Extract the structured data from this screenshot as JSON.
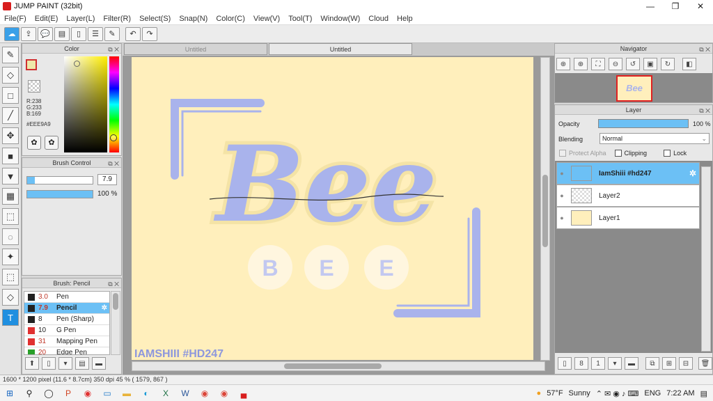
{
  "window": {
    "title": "JUMP PAINT (32bit)",
    "minimize": "—",
    "maximize": "❐",
    "close": "✕"
  },
  "menu": [
    "File(F)",
    "Edit(E)",
    "Layer(L)",
    "Filter(R)",
    "Select(S)",
    "Snap(N)",
    "Color(C)",
    "View(V)",
    "Tool(T)",
    "Window(W)",
    "Cloud",
    "Help"
  ],
  "doc_tabs": [
    "Untitled",
    "Untitled"
  ],
  "color_panel": {
    "title": "Color",
    "r": "R:238",
    "g": "G:233",
    "b": "B:169",
    "hex": "#EEE9A9",
    "fg_color": "#eee9a9"
  },
  "brush_control": {
    "title": "Brush Control",
    "size": "7.9",
    "opacity": "100 %"
  },
  "brush_list": {
    "title": "Brush: Pencil",
    "items": [
      {
        "size": "3.0",
        "name": "Pen",
        "color": "#222222"
      },
      {
        "size": "7.9",
        "name": "Pencil",
        "color": "#222222"
      },
      {
        "size": "8",
        "name": "Pen (Sharp)",
        "color": "#222222"
      },
      {
        "size": "10",
        "name": "G Pen",
        "color": "#e03030"
      },
      {
        "size": "31",
        "name": "Mapping Pen",
        "color": "#e03030"
      },
      {
        "size": "20",
        "name": "Edge Pen",
        "color": "#2aa02a"
      }
    ]
  },
  "artwork": {
    "title_text": "Bee",
    "circles": [
      "B",
      "E",
      "E"
    ],
    "signature": "IAMSHIII #HD247"
  },
  "navigator": {
    "title": "Navigator",
    "thumb_text": "Bee"
  },
  "layer_panel": {
    "title": "Layer",
    "opacity_label": "Opacity",
    "opacity_value": "100 %",
    "blending_label": "Blending",
    "blending_value": "Normal",
    "protect_alpha": "Protect Alpha",
    "clipping": "Clipping",
    "lock": "Lock",
    "layers": [
      {
        "name": "IamShiii #hd247"
      },
      {
        "name": "Layer2"
      },
      {
        "name": "Layer1"
      }
    ]
  },
  "status": "1600 * 1200 pixel  (11.6 * 8.7cm)  350 dpi  45 %  ( 1579, 867 )",
  "taskbar": {
    "weather_temp": "57°F",
    "weather_desc": "Sunny",
    "lang": "ENG",
    "time": "7:22 AM"
  },
  "colors": {
    "accent_blue": "#6cc0f5",
    "lavender": "#a9b3ec",
    "canvas_bg": "#ffefbc"
  }
}
